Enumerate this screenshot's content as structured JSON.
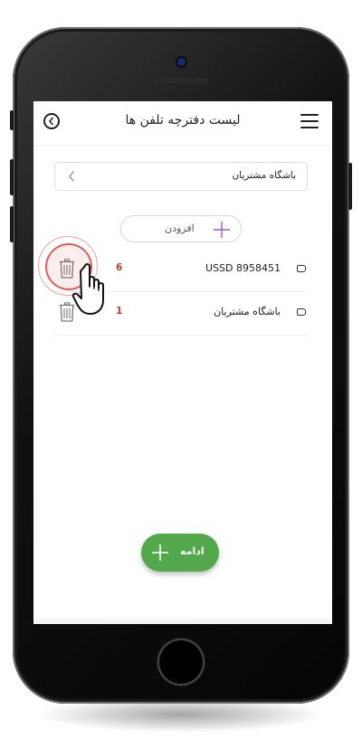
{
  "header": {
    "title": "لیست دفترچه تلفن ها"
  },
  "selector": {
    "value": "باشگاه مشتریان"
  },
  "add_button": {
    "label": "افزودن"
  },
  "rows": [
    {
      "label": "USSD 8958451",
      "count": "6"
    },
    {
      "label": "باشگاه مشتریان",
      "count": "1"
    }
  ],
  "continue_button": {
    "label": "ادامه"
  },
  "colors": {
    "accent_green": "#52a84a",
    "count_red": "#c0392b",
    "add_plus_purple": "#9b59d0",
    "highlight_red": "#e02a2a"
  },
  "icons": {
    "back": "chevron-left-circle-icon",
    "menu": "hamburger-menu-icon",
    "select": "chevron-left-icon",
    "add": "plus-icon",
    "delete": "trash-icon",
    "tag": "tag-icon",
    "pointer": "hand-pointer-icon",
    "continue": "plus-icon"
  }
}
